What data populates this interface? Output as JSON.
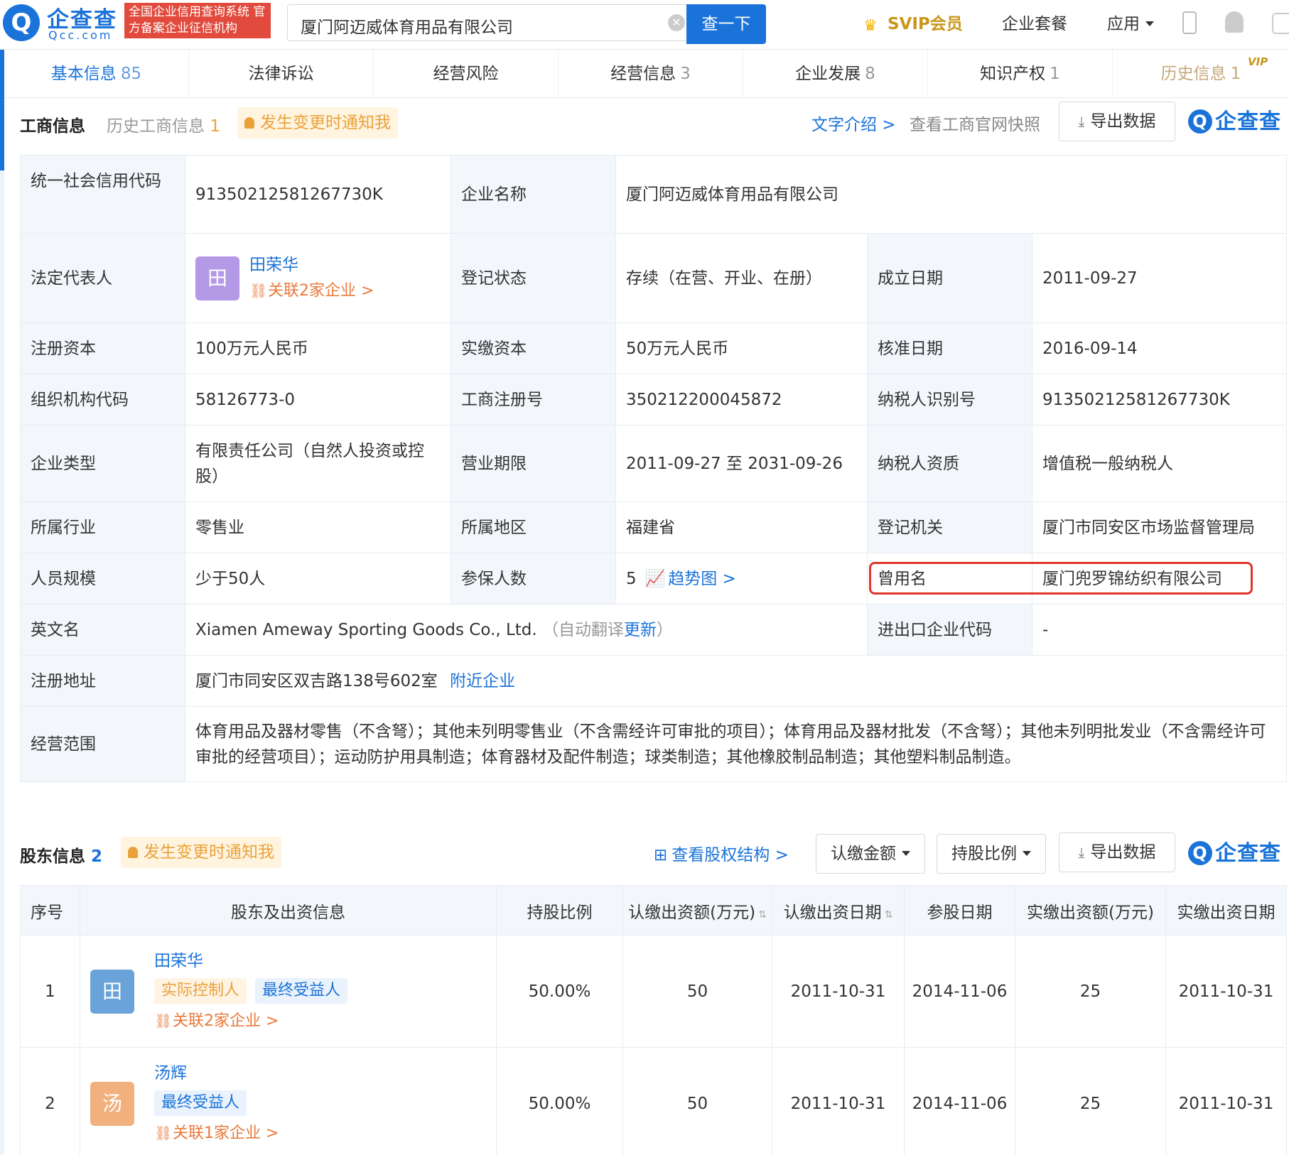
{
  "topbar": {
    "logo_cn": "企查查",
    "logo_en": "Qcc.com",
    "logo_tag": "全国企业信用查询系统 官方备案企业征信机构",
    "search_value": "厦门阿迈威体育用品有限公司",
    "search_button": "查一下",
    "svip": "SVIP会员",
    "nav": [
      "企业套餐",
      "应用"
    ]
  },
  "tabs": [
    {
      "label": "基本信息",
      "count": "85"
    },
    {
      "label": "法律诉讼",
      "count": ""
    },
    {
      "label": "经营风险",
      "count": ""
    },
    {
      "label": "经营信息",
      "count": "3"
    },
    {
      "label": "企业发展",
      "count": "8"
    },
    {
      "label": "知识产权",
      "count": "1"
    },
    {
      "label": "历史信息",
      "count": "1",
      "sup": "VIP"
    }
  ],
  "business": {
    "title": "工商信息",
    "history": "历史工商信息",
    "history_count": "1",
    "notify": "发生变更时通知我",
    "text_intro": "文字介绍 >",
    "snapshot": "查看工商官网快照",
    "export": "导出数据",
    "brand": "企查查"
  },
  "info": {
    "credit_code_label": "统一社会信用代码",
    "credit_code": "91350212581267730K",
    "company_name_label": "企业名称",
    "company_name": "厦门阿迈威体育用品有限公司",
    "legal_rep_label": "法定代表人",
    "legal_rep": "田荣华",
    "legal_rep_avatar": "田",
    "legal_rep_related": "关联2家企业 >",
    "status_label": "登记状态",
    "status": "存续（在营、开业、在册）",
    "founded_label": "成立日期",
    "founded": "2011-09-27",
    "reg_capital_label": "注册资本",
    "reg_capital": "100万元人民币",
    "paid_capital_label": "实缴资本",
    "paid_capital": "50万元人民币",
    "approved_label": "核准日期",
    "approved": "2016-09-14",
    "org_code_label": "组织机构代码",
    "org_code": "58126773-0",
    "reg_no_label": "工商注册号",
    "reg_no": "350212200045872",
    "taxpayer_id_label": "纳税人识别号",
    "taxpayer_id": "91350212581267730K",
    "type_label": "企业类型",
    "type": "有限责任公司（自然人投资或控股）",
    "term_label": "营业期限",
    "term": "2011-09-27 至 2031-09-26",
    "tax_qual_label": "纳税人资质",
    "tax_qual": "增值税一般纳税人",
    "industry_label": "所属行业",
    "industry": "零售业",
    "region_label": "所属地区",
    "region": "福建省",
    "authority_label": "登记机关",
    "authority": "厦门市同安区市场监督管理局",
    "staff_label": "人员规模",
    "staff": "少于50人",
    "insured_label": "参保人数",
    "insured": "5",
    "trend": "趋势图 >",
    "former_name_label": "曾用名",
    "former_name": "厦门兜罗锦纺织有限公司",
    "english_label": "英文名",
    "english": "Xiamen Ameway Sporting Goods Co., Ltd.",
    "auto_translate": "（自动翻译",
    "update": "更新",
    "close_paren": "）",
    "import_export_label": "进出口企业代码",
    "import_export": "-",
    "address_label": "注册地址",
    "address": "厦门市同安区双吉路138号602室",
    "nearby": "附近企业",
    "scope_label": "经营范围",
    "scope": "体育用品及器材零售（不含弩）；其他未列明零售业（不含需经许可审批的项目）；体育用品及器材批发（不含弩）；其他未列明批发业（不含需经许可审批的经营项目）；运动防护用具制造；体育器材及配件制造；球类制造；其他橡胶制品制造；其他塑料制品制造。"
  },
  "shareholders": {
    "title": "股东信息",
    "count": "2",
    "notify": "发生变更时通知我",
    "structure": "查看股权结构 >",
    "filter_amount": "认缴金额",
    "filter_ratio": "持股比例",
    "export": "导出数据",
    "brand": "企查查",
    "headers": [
      "序号",
      "股东及出资信息",
      "持股比例",
      "认缴出资额(万元)",
      "认缴出资日期",
      "参股日期",
      "实缴出资额(万元)",
      "实缴出资日期"
    ],
    "rows": [
      {
        "no": "1",
        "avatar": "田",
        "name": "田荣华",
        "tag1": "实际控制人",
        "tag2": "最终受益人",
        "related": "关联2家企业 >",
        "ratio": "50.00%",
        "subscribed": "50",
        "sub_date": "2011-10-31",
        "join_date": "2014-11-06",
        "paid": "25",
        "paid_date": "2011-10-31"
      },
      {
        "no": "2",
        "avatar": "汤",
        "name": "汤辉",
        "tag1": "",
        "tag2": "最终受益人",
        "related": "关联1家企业 >",
        "ratio": "50.00%",
        "subscribed": "50",
        "sub_date": "2011-10-31",
        "join_date": "2014-11-06",
        "paid": "25",
        "paid_date": "2011-10-31"
      }
    ]
  }
}
